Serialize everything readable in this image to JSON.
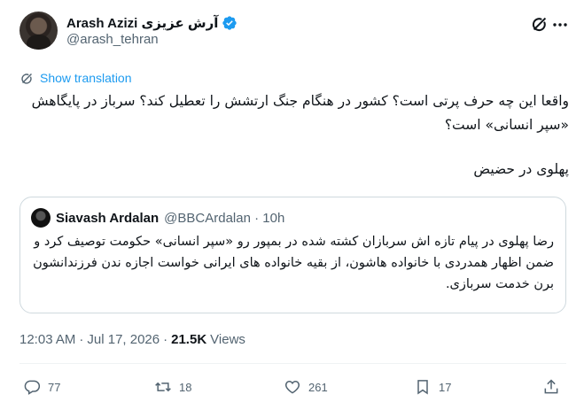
{
  "author": {
    "display_name": "Arash Azizi آرش عزیزی",
    "handle": "@arash_tehran"
  },
  "translate_label": "Show translation",
  "tweet": {
    "text_line1": "واقعا این چه حرف پرتی است؟ کشور در هنگام جنگ ارتشش را تعطیل کند؟ سرباز در پایگاهش «سپر انسانی» است؟",
    "text_line2": "پهلوی در حضیض"
  },
  "quote": {
    "display_name": "Siavash Ardalan",
    "handle": "@BBCArdalan",
    "time": "10h",
    "text": "رضا پهلوی در پیام تازه اش سربازان کشته شده در بمپور رو «سپر انسانی» حکومت توصیف کرد و ضمن اظهار همدردی با خانواده هاشون، از بقیه خانواده های ایرانی خواست اجازه ندن فرزندانشون برن خدمت سربازی."
  },
  "meta": {
    "time": "12:03 AM",
    "date": "Jul 17, 2026",
    "views_count": "21.5K",
    "views_label": "Views"
  },
  "actions": {
    "replies": "77",
    "reposts": "18",
    "likes": "261",
    "bookmarks": "17"
  },
  "colors": {
    "accent": "#1d9bf0",
    "secondary_text": "#536471",
    "border": "#cfd9de"
  },
  "icons": [
    "verified-badge-icon",
    "grok-icon",
    "more-icon",
    "translate-icon",
    "reply-icon",
    "retweet-icon",
    "like-icon",
    "bookmark-icon",
    "share-icon"
  ]
}
